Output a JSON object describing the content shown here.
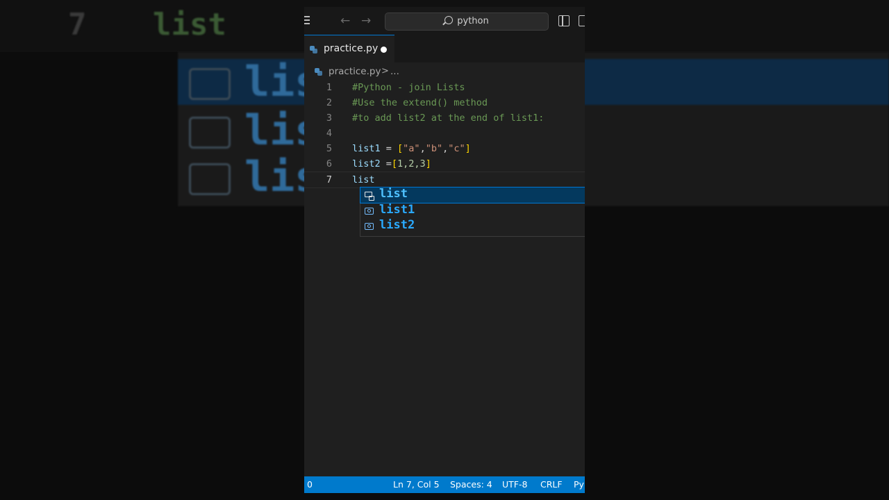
{
  "background": {
    "line_number": "7",
    "word": "list",
    "suggestions": [
      "list",
      "lis",
      "lis"
    ]
  },
  "titlebar": {
    "search_text": "python"
  },
  "tab": {
    "filename": "practice.py",
    "dirty": true
  },
  "breadcrumb": {
    "file": "practice.py",
    "separator": ">",
    "more": "..."
  },
  "editor": {
    "lines": [
      {
        "number": "1",
        "text": "#Python - join Lists"
      },
      {
        "number": "2",
        "text": "#Use the extend() method"
      },
      {
        "number": "3",
        "text": "#to add list2 at the end of list1:"
      },
      {
        "number": "4",
        "text": ""
      },
      {
        "number": "5",
        "text": "list1 = [\"a\",\"b\",\"c\"]"
      },
      {
        "number": "6",
        "text": "list2 =[1,2,3]"
      },
      {
        "number": "7",
        "text": "list"
      }
    ],
    "tokens": {
      "l5_name": "list1",
      "l5_eq": " = ",
      "l5_open": "[",
      "l5_a": "\"a\"",
      "l5_b": "\"b\"",
      "l5_c": "\"c\"",
      "comma": ",",
      "l5_close": "]",
      "l6_name": "list2",
      "l6_eq": " =",
      "l6_open": "[",
      "l6_vals": "1,2,3",
      "l6_close": "]",
      "l7_word": "list"
    }
  },
  "suggestions": [
    {
      "label": "list",
      "kind": "class",
      "selected": true
    },
    {
      "label": "list1",
      "kind": "variable",
      "selected": false
    },
    {
      "label": "list2",
      "kind": "variable",
      "selected": false
    }
  ],
  "statusbar": {
    "problems": "0",
    "position": "Ln 7, Col 5",
    "spaces": "Spaces: 4",
    "encoding": "UTF-8",
    "eol": "CRLF",
    "language": "Py"
  },
  "colors": {
    "accent": "#007acc",
    "comment": "#6a9955",
    "suggestion_text": "#2aaaff"
  }
}
